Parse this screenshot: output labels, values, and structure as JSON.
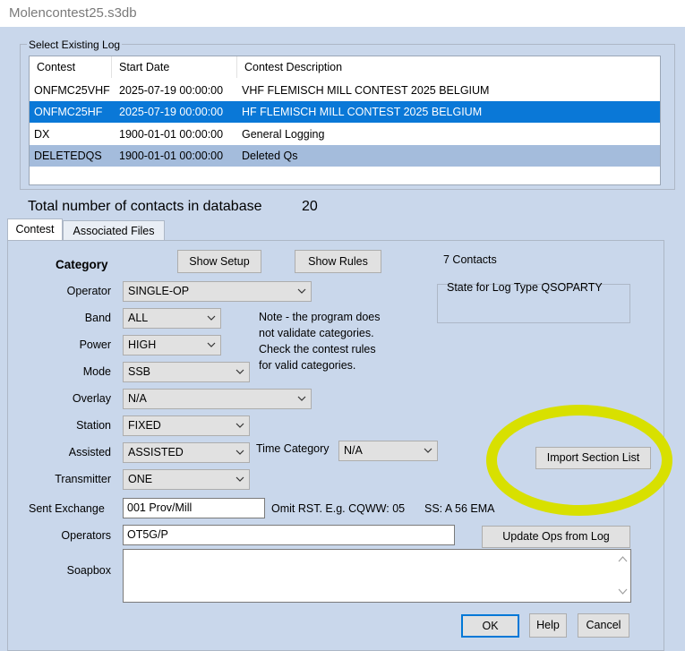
{
  "window": {
    "title": "Molencontest25.s3db"
  },
  "log_group": {
    "legend": "Select Existing Log",
    "columns": [
      "Contest",
      "Start Date",
      "Contest Description"
    ],
    "rows": [
      {
        "contest": "ONFMC25VHF",
        "start": "2025-07-19 00:00:00",
        "desc": "VHF FLEMISCH MILL CONTEST 2025 BELGIUM"
      },
      {
        "contest": "ONFMC25HF",
        "start": "2025-07-19 00:00:00",
        "desc": "HF FLEMISCH MILL CONTEST 2025 BELGIUM"
      },
      {
        "contest": "DX",
        "start": "1900-01-01 00:00:00",
        "desc": "General Logging"
      },
      {
        "contest": "DELETEDQS",
        "start": "1900-01-01 00:00:00",
        "desc": "Deleted Qs"
      }
    ]
  },
  "totals": {
    "label": "Total number of contacts in database",
    "value": "20"
  },
  "tabs": [
    "Contest",
    "Associated Files"
  ],
  "contest": {
    "category_heading": "Category",
    "show_setup": "Show Setup",
    "show_rules": "Show Rules",
    "contacts": "7 Contacts",
    "state_label": "State for Log Type QSOPARTY",
    "note": [
      "Note -  the program does",
      "not validate categories.",
      "Check the contest rules",
      "for valid categories."
    ],
    "fields": {
      "operator": {
        "label": "Operator",
        "value": "SINGLE-OP"
      },
      "band": {
        "label": "Band",
        "value": "ALL"
      },
      "power": {
        "label": "Power",
        "value": "HIGH"
      },
      "mode": {
        "label": "Mode",
        "value": "SSB"
      },
      "overlay": {
        "label": "Overlay",
        "value": "N/A"
      },
      "station": {
        "label": "Station",
        "value": "FIXED"
      },
      "assisted": {
        "label": "Assisted",
        "value": "ASSISTED"
      },
      "time_category": {
        "label": "Time Category",
        "value": "N/A"
      },
      "transmitter": {
        "label": "Transmitter",
        "value": "ONE"
      }
    },
    "import_section": "Import Section List",
    "sent_exchange": {
      "label": "Sent Exchange",
      "value": "001 Prov/Mill",
      "hint1": "Omit RST. E.g. CQWW: 05",
      "hint2": "SS: A 56 EMA"
    },
    "operators": {
      "label": "Operators",
      "value": "OT5G/P"
    },
    "update_ops": "Update Ops from Log",
    "soapbox": {
      "label": "Soapbox",
      "value": ""
    },
    "ok": "OK",
    "help": "Help",
    "cancel": "Cancel"
  },
  "colors": {
    "selection": "#0a78d7",
    "highlight_annotation": "#d8e000"
  }
}
